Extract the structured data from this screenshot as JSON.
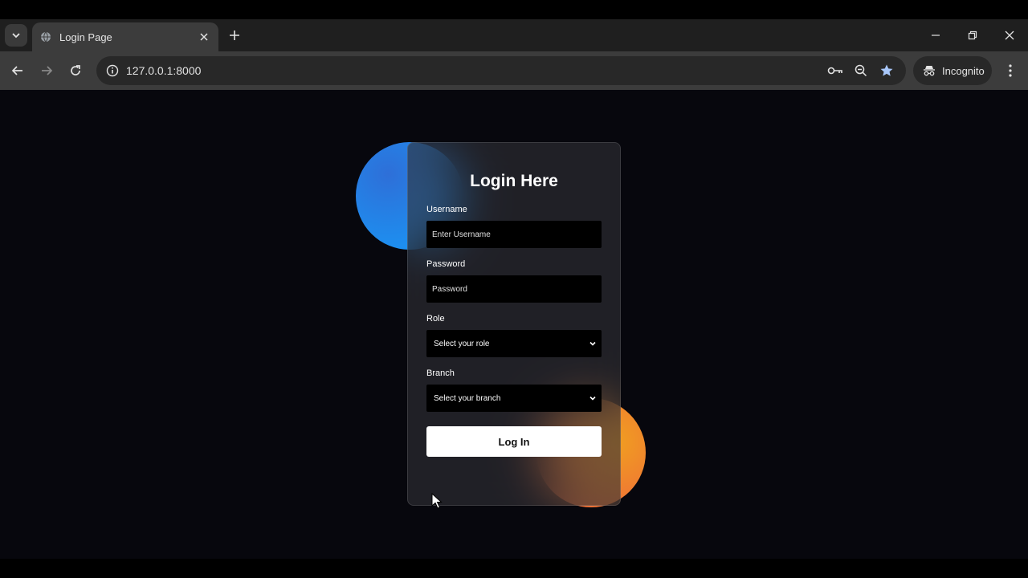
{
  "browser": {
    "tab": {
      "title": "Login Page"
    },
    "address_bar": {
      "url": "127.0.0.1:8000"
    },
    "profile": {
      "label": "Incognito"
    }
  },
  "login_form": {
    "title": "Login Here",
    "username": {
      "label": "Username",
      "placeholder": "Enter Username"
    },
    "password": {
      "label": "Password",
      "placeholder": "Password"
    },
    "role": {
      "label": "Role",
      "selected": "Select your role"
    },
    "branch": {
      "label": "Branch",
      "selected": "Select your branch"
    },
    "submit_label": "Log In"
  },
  "colors": {
    "page_background": "#07070d",
    "blob_blue": "#1d8ff0",
    "blob_orange": "#ef8a30",
    "button_background": "#ffffff",
    "star_accent": "#a8c7fa"
  }
}
